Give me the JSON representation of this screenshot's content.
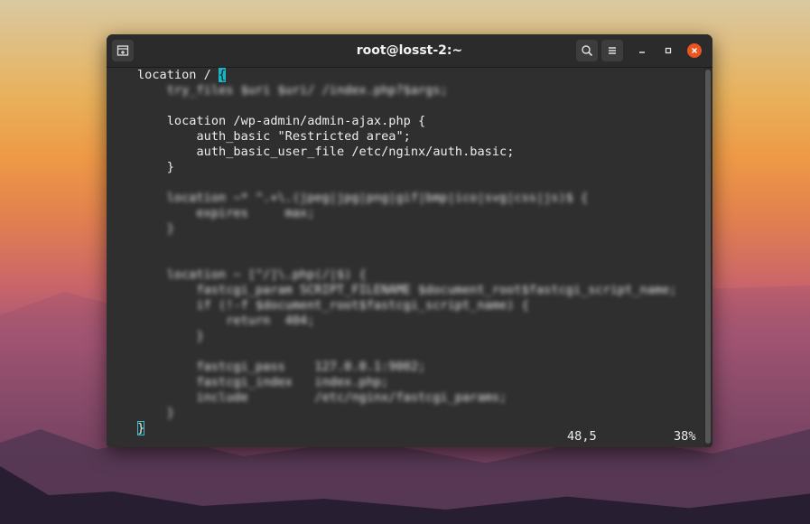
{
  "window": {
    "title": "root@losst-2:~",
    "icons": {
      "new_tab": "new-tab-icon",
      "search": "search-icon",
      "menu": "hamburger-menu-icon",
      "minimize": "minimize-icon",
      "maximize": "maximize-icon",
      "close": "close-icon"
    },
    "close_color": "#e95420"
  },
  "editor": {
    "lines": [
      {
        "pre": "location / ",
        "cursor": "{",
        "post": ""
      },
      {
        "text": "    try_files $uri $uri/ /index.php?$args;"
      },
      {
        "text": ""
      },
      {
        "text": "    location /wp-admin/admin-ajax.php {"
      },
      {
        "text": "        auth_basic \"Restricted area\";"
      },
      {
        "text": "        auth_basic_user_file /etc/nginx/auth.basic;"
      },
      {
        "text": "    }"
      },
      {
        "text": ""
      },
      {
        "text": "    location ~* ^.+\\.(jpeg|jpg|png|gif|bmp|ico|svg|css|js)$ {"
      },
      {
        "text": "        expires     max;"
      },
      {
        "text": "    }"
      },
      {
        "text": ""
      },
      {
        "text": ""
      },
      {
        "text": "    location ~ [^/]\\.php(/|$) {"
      },
      {
        "text": "        fastcgi_param SCRIPT_FILENAME $document_root$fastcgi_script_name;"
      },
      {
        "text": "        if (!-f $document_root$fastcgi_script_name) {"
      },
      {
        "text": "            return  404;"
      },
      {
        "text": "        }"
      },
      {
        "text": ""
      },
      {
        "text": "        fastcgi_pass    127.0.0.1:9002;"
      },
      {
        "text": "        fastcgi_index   index.php;"
      },
      {
        "text": "        include         /etc/nginx/fastcgi_params;"
      },
      {
        "text": "    }"
      },
      {
        "cursor": "}"
      }
    ],
    "cursor_color": "#19b5c4",
    "status": {
      "position": "48,5",
      "percent": "38%"
    }
  }
}
